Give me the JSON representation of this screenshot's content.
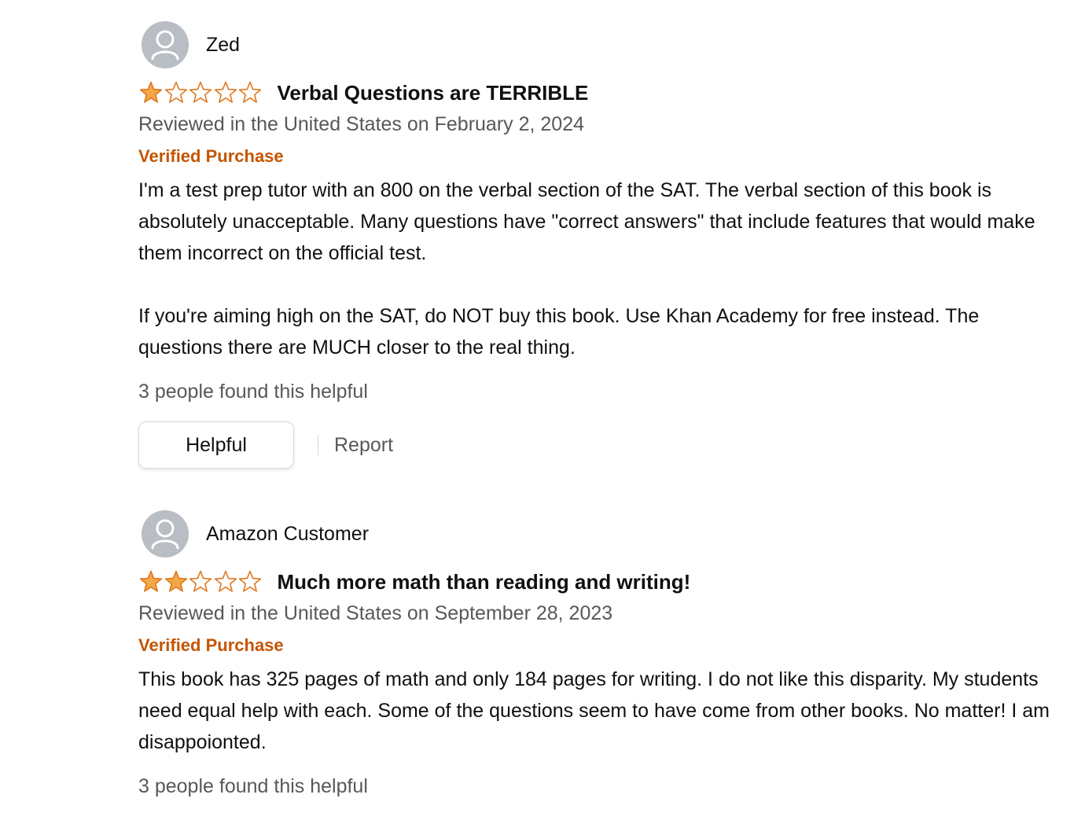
{
  "colors": {
    "star_filled": "#f3a847",
    "star_empty": "#de7921",
    "verified": "#c45500",
    "muted_text": "#565959"
  },
  "reviews": [
    {
      "profile_name": "Zed",
      "rating": 1,
      "rating_max": 5,
      "title": "Verbal Questions are TERRIBLE",
      "date": "Reviewed in the United States on February 2, 2024",
      "badge": "Verified Purchase",
      "body": [
        "I'm a test prep tutor with an 800 on the verbal section of the SAT. The verbal section of this book is absolutely unacceptable. Many questions have \"correct answers\" that include features that would make them incorrect on the official test.",
        "If you're aiming high on the SAT, do NOT buy this book. Use Khan Academy for free instead. The questions there are MUCH closer to the real thing."
      ],
      "helpful_count_text": "3 people found this helpful",
      "helpful_label": "Helpful",
      "report_label": "Report"
    },
    {
      "profile_name": "Amazon Customer",
      "rating": 2,
      "rating_max": 5,
      "title": "Much more math than reading and writing!",
      "date": "Reviewed in the United States on September 28, 2023",
      "badge": "Verified Purchase",
      "body": [
        "This book has 325 pages of math and only 184 pages for writing. I do not like this disparity. My students need equal help with each. Some of the questions seem to have come from other books. No matter! I am disappoionted."
      ],
      "helpful_count_text": "3 people found this helpful"
    }
  ]
}
